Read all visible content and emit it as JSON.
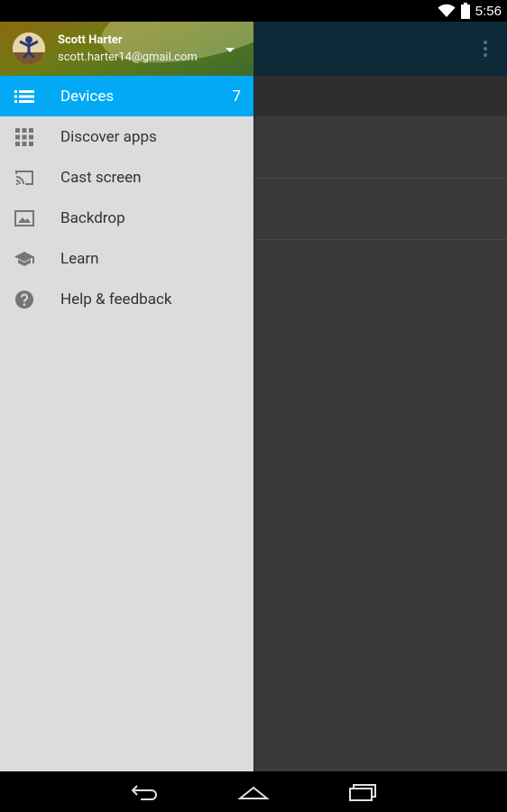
{
  "status_bar": {
    "time": "5:56",
    "icons": [
      "wifi-icon",
      "battery-icon"
    ]
  },
  "drawer": {
    "account": {
      "name": "Scott Harter",
      "email": "scott.harter14@gmail.com"
    },
    "items": [
      {
        "label": "Devices",
        "icon": "list-icon",
        "count": "7",
        "selected": true
      },
      {
        "label": "Discover apps",
        "icon": "grid-apps-icon"
      },
      {
        "label": "Cast screen",
        "icon": "cast-icon"
      },
      {
        "label": "Backdrop",
        "icon": "image-icon"
      },
      {
        "label": "Learn",
        "icon": "school-cap-icon"
      },
      {
        "label": "Help & feedback",
        "icon": "help-icon"
      }
    ]
  },
  "colors": {
    "accent": "#03a9f4",
    "toolbar": "#0d2a39",
    "drawer_bg": "#dcdcdc"
  },
  "nav_bar": {
    "buttons": [
      "back-icon",
      "home-icon",
      "recents-icon"
    ]
  }
}
